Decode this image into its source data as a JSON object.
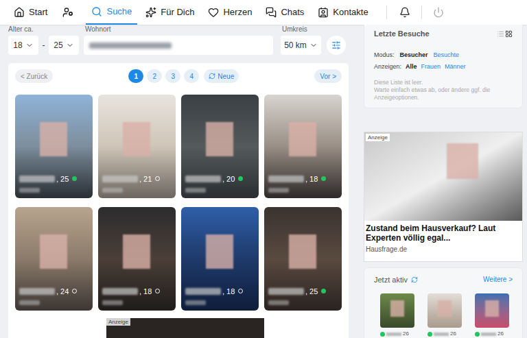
{
  "nav": {
    "items": [
      {
        "label": "Start",
        "selected": false
      },
      {
        "label": "Suche",
        "selected": true
      },
      {
        "label": "Für Dich",
        "selected": false
      },
      {
        "label": "Herzen",
        "selected": false
      },
      {
        "label": "Chats",
        "selected": false
      },
      {
        "label": "Kontakte",
        "selected": false
      }
    ]
  },
  "filters": {
    "age_label": "Alter ca.",
    "age_from": "18",
    "age_separator": "-",
    "age_to": "25",
    "location_label": "Wohnort",
    "radius_label": "Umkreis",
    "radius": "50 km"
  },
  "pagination": {
    "prev": "< Zurück",
    "pages": [
      {
        "label": "1",
        "selected": true
      },
      {
        "label": "2",
        "selected": false
      },
      {
        "label": "3",
        "selected": false
      },
      {
        "label": "4",
        "selected": false
      }
    ],
    "refresh": "Neue",
    "next": "Vor >"
  },
  "profiles": [
    {
      "age": ", 25",
      "online": true
    },
    {
      "age": ", 21",
      "online": false
    },
    {
      "age": ", 20",
      "online": true
    },
    {
      "age": ", 18",
      "online": true
    },
    {
      "age": ", 24",
      "online": false
    },
    {
      "age": ", 18",
      "online": false
    },
    {
      "age": ", 18",
      "online": false
    },
    {
      "age": ", 25",
      "online": true
    }
  ],
  "bottom_ad": {
    "label": "Anzeige"
  },
  "last_visits": {
    "title": "Letzte Besuche",
    "grid_view_selected": true,
    "mode_label": "Modus:",
    "modes": [
      {
        "label": "Besucher",
        "selected": true
      },
      {
        "label": "Besuchte",
        "selected": false
      }
    ],
    "show_label": "Anzeigen:",
    "show_options": [
      {
        "label": "Alle",
        "selected": true
      },
      {
        "label": "Frauen",
        "selected": false
      },
      {
        "label": "Männer",
        "selected": false
      }
    ],
    "empty_lines": [
      "Diese Liste ist leer.",
      "Warte einfach etwas ab, oder ändere ggf. die Anzeigeoptionen."
    ]
  },
  "ad": {
    "label": "Anzeige",
    "headline": "Zustand beim Hausverkauf? Laut Experten völlig egal...",
    "source": "Hausfrage.de"
  },
  "active_now": {
    "title": "Jetzt aktiv",
    "more": "Weitere >",
    "users": [
      {
        "age": "26",
        "online": true
      },
      {
        "age": "26",
        "online": true
      },
      {
        "age": "26",
        "online": true
      }
    ]
  }
}
